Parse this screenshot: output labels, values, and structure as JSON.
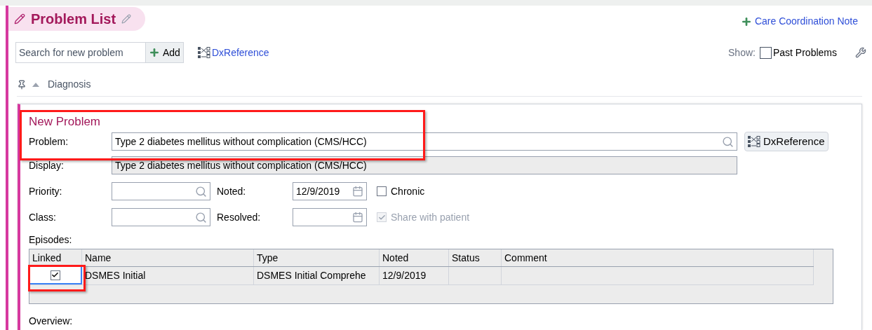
{
  "header": {
    "title": "Problem List",
    "care_note_link": "Care Coordination Note"
  },
  "toolbar": {
    "search": {
      "placeholder": "Search for new problem"
    },
    "add_button": "Add",
    "dx_link": "DxReference",
    "show_label": "Show:",
    "past_problems": {
      "label": "Past Problems",
      "checked": false
    }
  },
  "list_header": {
    "column": "Diagnosis"
  },
  "form": {
    "title": "New Problem",
    "highlighted": true,
    "problem": {
      "label": "Problem:",
      "value": "Type 2 diabetes mellitus without complication (CMS/HCC)"
    },
    "dx_button": "DxReference",
    "display": {
      "label": "Display:",
      "value": "Type 2 diabetes mellitus without complication (CMS/HCC)"
    },
    "priority": {
      "label": "Priority:"
    },
    "noted": {
      "label": "Noted:",
      "value": "12/9/2019"
    },
    "chronic": {
      "label": "Chronic",
      "checked": false,
      "disabled": false
    },
    "class": {
      "label": "Class:"
    },
    "resolved": {
      "label": "Resolved:"
    },
    "share": {
      "label": "Share with patient",
      "checked": true,
      "disabled": true
    },
    "episodes": {
      "label": "Episodes:",
      "columns": [
        "Linked",
        "Name",
        "Type",
        "Noted",
        "Status",
        "Comment"
      ],
      "rows": [
        {
          "linked": true,
          "highlighted": true,
          "name": "DSMES Initial",
          "type": "DSMES Initial Comprehe",
          "noted": "12/9/2019"
        }
      ]
    },
    "overview_label": "Overview:"
  }
}
